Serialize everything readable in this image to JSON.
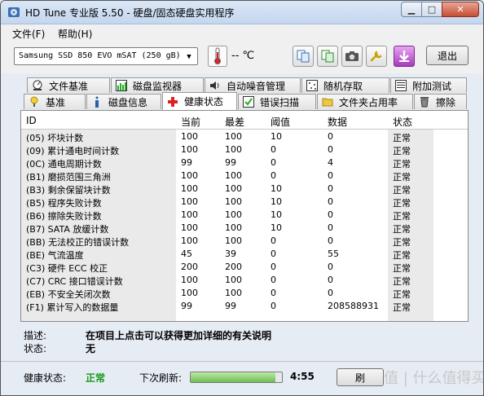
{
  "window": {
    "title": "HD Tune 专业版 5.50 - 硬盘/固态硬盘实用程序"
  },
  "menu": [
    {
      "label": "文件(F)"
    },
    {
      "label": "帮助(H)"
    }
  ],
  "toolbar": {
    "drive": "Samsung SSD 850 EVO mSAT (250 gB)",
    "temperature": "-- ℃",
    "exit_label": "退出"
  },
  "tabs_row1": [
    {
      "label": "文件基准",
      "icon": "file-benchmark-icon"
    },
    {
      "label": "磁盘监视器",
      "icon": "disk-monitor-icon"
    },
    {
      "label": "自动噪音管理",
      "icon": "speaker-icon"
    },
    {
      "label": "随机存取",
      "icon": "random-access-icon"
    },
    {
      "label": "附加测试",
      "icon": "extra-tests-icon"
    }
  ],
  "tabs_row2": [
    {
      "label": "基准",
      "icon": "benchmark-icon"
    },
    {
      "label": "磁盘信息",
      "icon": "info-icon"
    },
    {
      "label": "健康状态",
      "icon": "health-icon",
      "active": true
    },
    {
      "label": "错误扫描",
      "icon": "error-scan-icon"
    },
    {
      "label": "文件夹占用率",
      "icon": "folder-icon"
    },
    {
      "label": "擦除",
      "icon": "erase-icon"
    }
  ],
  "table": {
    "headers": [
      "ID",
      "当前",
      "最差",
      "阈值",
      "数据",
      "状态"
    ],
    "rows": [
      {
        "id": "(05) 坏块计数",
        "current": "100",
        "worst": "100",
        "threshold": "10",
        "data": "0",
        "status": "正常"
      },
      {
        "id": "(09) 累计通电时间计数",
        "current": "100",
        "worst": "100",
        "threshold": "0",
        "data": "0",
        "status": "正常"
      },
      {
        "id": "(0C) 通电周期计数",
        "current": "99",
        "worst": "99",
        "threshold": "0",
        "data": "4",
        "status": "正常"
      },
      {
        "id": "(B1) 磨损范围三角洲",
        "current": "100",
        "worst": "100",
        "threshold": "0",
        "data": "0",
        "status": "正常"
      },
      {
        "id": "(B3) 剩余保留块计数",
        "current": "100",
        "worst": "100",
        "threshold": "10",
        "data": "0",
        "status": "正常"
      },
      {
        "id": "(B5) 程序失败计数",
        "current": "100",
        "worst": "100",
        "threshold": "10",
        "data": "0",
        "status": "正常"
      },
      {
        "id": "(B6) 擦除失败计数",
        "current": "100",
        "worst": "100",
        "threshold": "10",
        "data": "0",
        "status": "正常"
      },
      {
        "id": "(B7) SATA 放缓计数",
        "current": "100",
        "worst": "100",
        "threshold": "10",
        "data": "0",
        "status": "正常"
      },
      {
        "id": "(BB) 无法校正的错误计数",
        "current": "100",
        "worst": "100",
        "threshold": "0",
        "data": "0",
        "status": "正常"
      },
      {
        "id": "(BE) 气流温度",
        "current": "45",
        "worst": "39",
        "threshold": "0",
        "data": "55",
        "status": "正常"
      },
      {
        "id": "(C3) 硬件 ECC 校正",
        "current": "200",
        "worst": "200",
        "threshold": "0",
        "data": "0",
        "status": "正常"
      },
      {
        "id": "(C7) CRC 接口错误计数",
        "current": "100",
        "worst": "100",
        "threshold": "0",
        "data": "0",
        "status": "正常"
      },
      {
        "id": "(EB) 不安全关闭次数",
        "current": "100",
        "worst": "100",
        "threshold": "0",
        "data": "0",
        "status": "正常"
      },
      {
        "id": "(F1) 累计写入的数据量",
        "current": "99",
        "worst": "99",
        "threshold": "0",
        "data": "208588931",
        "status": "正常"
      }
    ]
  },
  "description": {
    "desc_label": "描述:",
    "desc_value": "在项目上点击可以获得更加详细的有关说明",
    "state_label": "状态:",
    "state_value": "无"
  },
  "status_bar": {
    "health_label": "健康状态:",
    "health_value": "正常",
    "refresh_label": "下次刷新:",
    "refresh_progress": 0.93,
    "countdown": "4:55",
    "refresh_button_label": "刷",
    "watermark": "值 | 什么值得买"
  },
  "colors": {
    "health_ok": "#1a9a1a",
    "title_gradient_top": "#dbe7f6"
  }
}
